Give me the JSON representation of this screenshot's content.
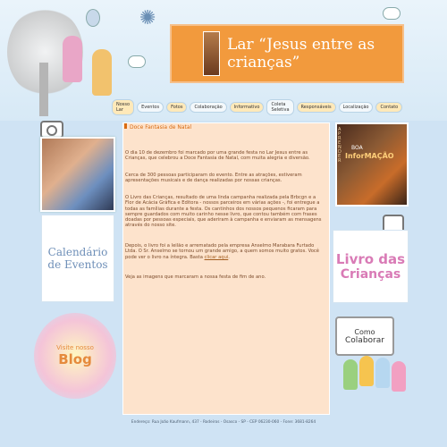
{
  "site": {
    "title": "Lar “Jesus entre as crianças”"
  },
  "nav": {
    "items": [
      "Nosso Lar",
      "Eventos",
      "Fotos",
      "Colaboração",
      "Informativo",
      "Coleta Seletiva",
      "Responsáveis",
      "Localização",
      "Contato"
    ]
  },
  "article": {
    "title": "Doce Fantasia de Natal",
    "paragraphs": [
      "O dia 10 de dezembro foi marcado por uma grande festa no Lar Jesus entre as Crianças, que celebrou a Doce Fantasia de Natal, com muita alegria e diversão.",
      "Cerca de 300 pessoas participaram do evento. Entre as atrações, estiveram apresentações musicais e de dança realizadas por nossas crianças.",
      "O Livro das Crianças, resultado de uma linda campanha realizada pela Brbcgn e a Flor de Acácia Gráfica e Editora - nossos parceiros em várias ações -, foi entregue a todas as famílias durante a festa. Os cantinhos dos nossos pequenos ficaram para sempre guardados com muito carinho nesse livro, que contou também com frases doadas por pessoas especiais, que aderiram à campanha e enviaram as mensagens através do nosso site.",
      "Depois, o livro foi a leilão e arrematado pela empresa Anselmo Marabara Furtado Ltda. O Sr. Anselmo se tornou um grande amigo, a quem somos muito gratos. Você pode ver o livro na íntegra. Basta",
      "Veja as imagens que marcaram a nossa festa de fim de ano."
    ],
    "link_text": "clicar aqui"
  },
  "sidebar_left": {
    "calendar": "Calendário de Eventos",
    "blog_line1": "Visite nosso",
    "blog_line2": "Blog"
  },
  "sidebar_right": {
    "photo_line1": "BOA",
    "photo_line2": "InforMAÇÃO",
    "photo_vertical": "APRENDER",
    "livro_line1": "Livro das",
    "livro_line2": "Crianças",
    "colab_line1": "Como",
    "colab_line2": "Colaborar"
  },
  "footer": {
    "text": "Endereço: Rua João Kaufmann, 437 - Rodeiros - Osasco - SP - CEP 06230-060 - Fone: 3681-8264"
  },
  "colors": {
    "accent": "#f29a3d",
    "content_bg": "#fde3cc",
    "page_bg": "#cfe3f4"
  }
}
